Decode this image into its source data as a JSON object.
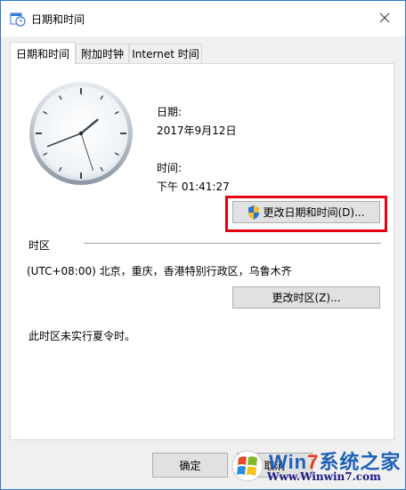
{
  "window": {
    "title": "日期和时间"
  },
  "tabs": [
    {
      "label": "日期和时间"
    },
    {
      "label": "附加时钟"
    },
    {
      "label": "Internet 时间"
    }
  ],
  "datetime": {
    "date_label": "日期:",
    "date_value": "2017年9月12日",
    "time_label": "时间:",
    "time_value": "下午 01:41:27",
    "change_button": "更改日期和时间(D)..."
  },
  "clock": {
    "hour": 1,
    "minute": 41,
    "second": 27
  },
  "timezone": {
    "section_label": "时区",
    "value": "(UTC+08:00) 北京，重庆，香港特别行政区，乌鲁木齐",
    "change_button": "更改时区(Z)...",
    "dst_note": "此时区未实行夏令时。"
  },
  "footer": {
    "ok_label": "确定",
    "cancel_label": "取消"
  },
  "watermark": {
    "brand_prefix": "Win",
    "brand_seven": "7",
    "brand_suffix": "系统之家",
    "url": "Www.Winwin7.com"
  },
  "colors": {
    "highlight": "#e60012",
    "window_border": "#2b79d0"
  }
}
